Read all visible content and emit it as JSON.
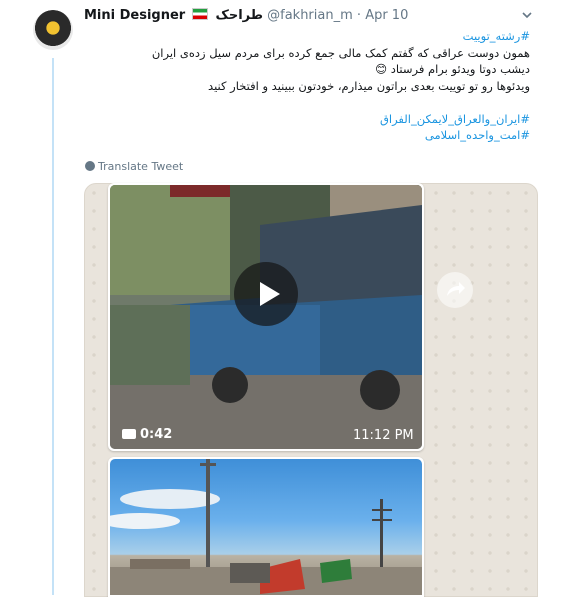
{
  "tweet": {
    "display_name": "Mini Designer",
    "rtl_name": "طراحک",
    "handle": "@fakhrian_m",
    "separator": "·",
    "date": "Apr 10",
    "lines": [
      "#رشته_توییت",
      "همون دوست عراقی که گفتم کمک مالی جمع کرده برای مردم سیل زده‌ی ایران",
      "دیشب دوتا ویدئو برام فرستاد 😊",
      "ویدئوها رو تو توییت بعدی براتون میذارم، خودتون ببینید و افتخار کنید",
      "",
      "#ایران_والعراق_لایمکن_الفراق",
      "#امت_واحده_اسلامی"
    ],
    "translate_label": "Translate Tweet"
  },
  "media": {
    "video1": {
      "duration": "0:42",
      "timestamp": "11:12 PM"
    }
  },
  "colors": {
    "link": "#1b95e0",
    "thread_line": "#c4e2f7",
    "meta": "#657786"
  },
  "icons": [
    "avatar",
    "iran-flag-icon",
    "chevron-down-icon",
    "globe-icon",
    "play-icon",
    "video-camera-icon",
    "share-arrow-icon"
  ]
}
